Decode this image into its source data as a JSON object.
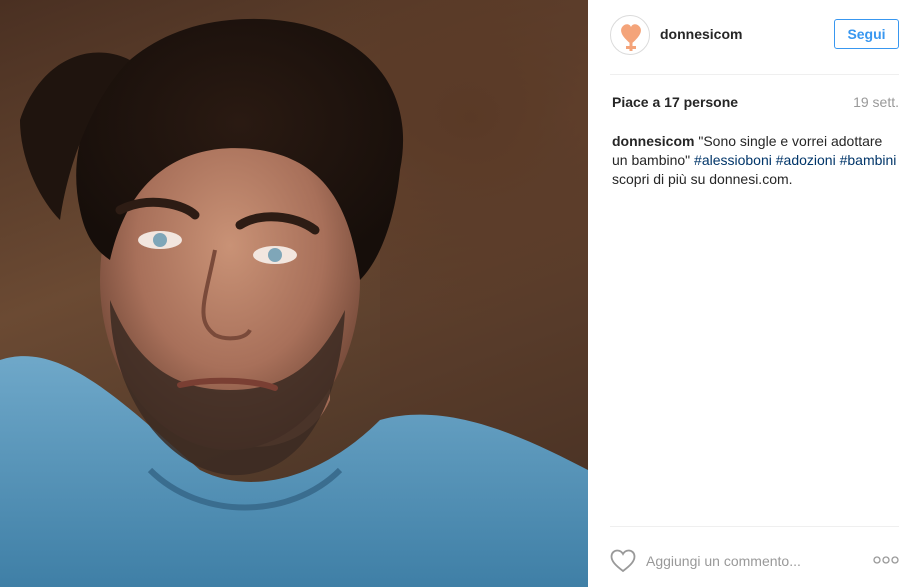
{
  "photo": {
    "alt": ""
  },
  "header": {
    "username": "donnesicom",
    "follow_label": "Segui"
  },
  "stats": {
    "likes": "Piace a 17 persone",
    "time": "19 sett."
  },
  "caption": {
    "username": "donnesicom",
    "text_before": " \"Sono single e vorrei adottare un bambino\" ",
    "tag1": "#alessioboni",
    "tag2": "#adozioni",
    "tag3": "#bambini",
    "text_after": " scopri di più su donnesi.com."
  },
  "comment": {
    "placeholder": "Aggiungi un commento..."
  },
  "colors": {
    "accent": "#3897f0",
    "hashtag": "#003569",
    "muted": "#999999"
  },
  "icons": {
    "avatar": "donnesi-logo",
    "like": "heart-outline-icon",
    "more": "more-options-icon"
  }
}
